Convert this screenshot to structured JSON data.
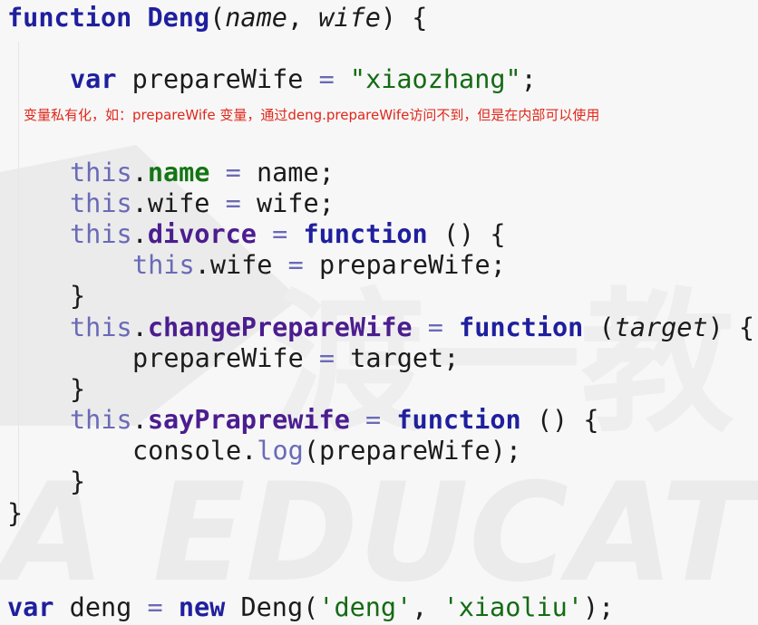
{
  "code": {
    "keyword_function": "function",
    "keyword_var": "var",
    "keyword_new": "new",
    "keyword_this": "this",
    "fn_name": "Deng",
    "param_name": "name",
    "param_wife": "wife",
    "param_target": "target",
    "var_prepareWife": "prepareWife",
    "string_xiaozhang": "\"xiaozhang\"",
    "prop_name": "name",
    "prop_wife": "wife",
    "prop_divorce": "divorce",
    "prop_changePrepareWife": "changePrepareWife",
    "prop_sayPraprewife": "sayPraprewife",
    "console": "console",
    "log": "log",
    "var_deng": "deng",
    "ctor_Deng": "Deng",
    "string_deng": "'deng'",
    "string_xiaoliu": "'xiaoliu'"
  },
  "annotation": {
    "text": "变量私有化，如：prepareWife 变量，通过deng.prepareWife访问不到，但是在内部可以使用"
  },
  "watermark": {
    "text": "A EDUCAT",
    "cn_text": "渡一教"
  },
  "colors": {
    "keyword": "#1f1f9e",
    "string": "#146b14",
    "this": "#6a6ab8",
    "annotation": "#e0281b",
    "background": "#f7f7f7"
  }
}
